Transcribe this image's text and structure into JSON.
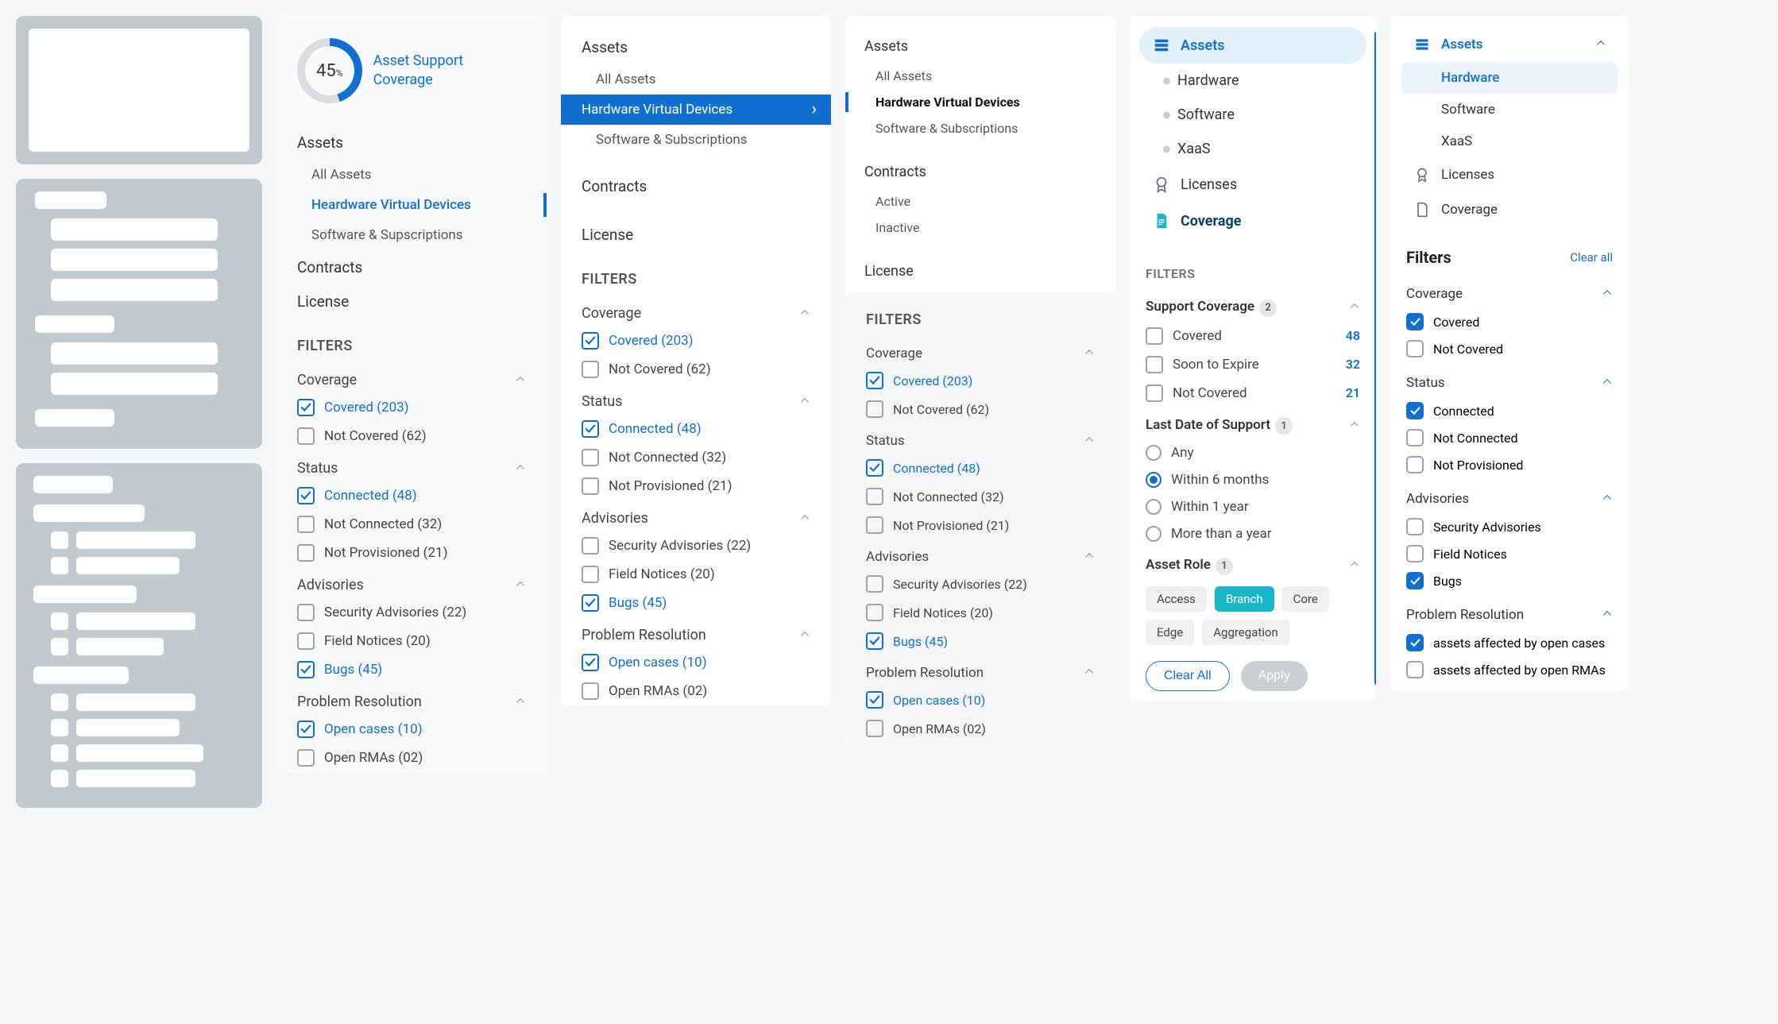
{
  "panel2": {
    "gauge_pct": "45",
    "gauge_unit": "%",
    "gauge_label": "Asset Support Coverage",
    "nav": {
      "assets": "Assets",
      "all": "All Assets",
      "hw": "Heardware Virtual Devices",
      "sw": "Software & Supscriptions",
      "contracts": "Contracts",
      "license": "License"
    },
    "filters_h": "FILTERS",
    "groups": {
      "coverage": {
        "title": "Coverage",
        "covered": "Covered (203)",
        "not": "Not Covered (62)"
      },
      "status": {
        "title": "Status",
        "conn": "Connected  (48)",
        "nconn": "Not Connected (32)",
        "nprov": "Not Provisioned (21)"
      },
      "adv": {
        "title": "Advisories",
        "sec": "Security Advisories (22)",
        "fn": "Field Notices (20)",
        "bugs": "Bugs (45)"
      },
      "pr": {
        "title": "Problem Resolution",
        "oc": "Open cases (10)",
        "or": "Open RMAs (02)"
      }
    }
  },
  "panel3": {
    "nav": {
      "assets": "Assets",
      "all": "All Assets",
      "hw": "Hardware Virtual Devices",
      "sw": "Software & Subscriptions",
      "contracts": "Contracts",
      "license": "License"
    },
    "filters_h": "FILTERS",
    "groups": {
      "coverage": {
        "title": "Coverage",
        "covered": "Covered (203)",
        "not": "Not Covered (62)"
      },
      "status": {
        "title": "Status",
        "conn": "Connected  (48)",
        "nconn": "Not Connected (32)",
        "nprov": "Not Provisioned (21)"
      },
      "adv": {
        "title": "Advisories",
        "sec": "Security Advisories (22)",
        "fn": "Field Notices (20)",
        "bugs": "Bugs (45)"
      },
      "pr": {
        "title": "Problem Resolution",
        "oc": "Open cases (10)",
        "or": "Open RMAs (02)"
      }
    }
  },
  "panel4": {
    "nav": {
      "assets": "Assets",
      "all": "All Assets",
      "hw": "Hardware Virtual Devices",
      "sw": "Software & Subscriptions",
      "contracts": "Contracts",
      "active": "Active",
      "inactive": "Inactive",
      "license": "License"
    },
    "filters_h": "FILTERS",
    "groups": {
      "coverage": {
        "title": "Coverage",
        "covered": "Covered (203)",
        "not": "Not Covered (62)"
      },
      "status": {
        "title": "Status",
        "conn": "Connected  (48)",
        "nconn": "Not Connected (32)",
        "nprov": "Not Provisioned (21)"
      },
      "adv": {
        "title": "Advisories",
        "sec": "Security Advisories (22)",
        "fn": "Field Notices (20)",
        "bugs": "Bugs (45)"
      },
      "pr": {
        "title": "Problem Resolution",
        "oc": "Open cases (10)",
        "or": "Open RMAs (02)"
      }
    }
  },
  "panel5": {
    "nav": {
      "assets": "Assets",
      "hw": "Hardware",
      "sw": "Software",
      "xaas": "XaaS",
      "lic": "Licenses",
      "cov": "Coverage"
    },
    "filters_h": "FILTERS",
    "g1": {
      "title": "Support Coverage",
      "badge": "2",
      "covered": "Covered",
      "covered_n": "48",
      "soon": "Soon to Expire",
      "soon_n": "32",
      "not": "Not Covered",
      "not_n": "21"
    },
    "g2": {
      "title": "Last Date of Support",
      "badge": "1",
      "any": "Any",
      "w6": "Within 6 months",
      "w1": "Within 1 year",
      "more": "More than a year"
    },
    "g3": {
      "title": "Asset Role",
      "badge": "1",
      "access": "Access",
      "branch": "Branch",
      "core": "Core",
      "edge": "Edge",
      "agg": "Aggregation"
    },
    "clear": "Clear All",
    "apply": "Apply"
  },
  "panel6": {
    "nav": {
      "assets": "Assets",
      "hw": "Hardware",
      "sw": "Software",
      "xaas": "XaaS",
      "lic": "Licenses",
      "cov": "Coverage"
    },
    "filters_h": "Filters",
    "clear": "Clear all",
    "g": {
      "cov": {
        "title": "Coverage",
        "c": "Covered",
        "nc": "Not Covered"
      },
      "st": {
        "title": "Status",
        "c": "Connected",
        "nc": "Not Connected",
        "np": "Not Provisioned"
      },
      "adv": {
        "title": "Advisories",
        "sa": "Security Advisories",
        "fn": "Field Notices",
        "b": "Bugs"
      },
      "pr": {
        "title": "Problem Resolution",
        "oc": "assets affected by open cases",
        "or": "assets affected by open RMAs"
      }
    }
  }
}
